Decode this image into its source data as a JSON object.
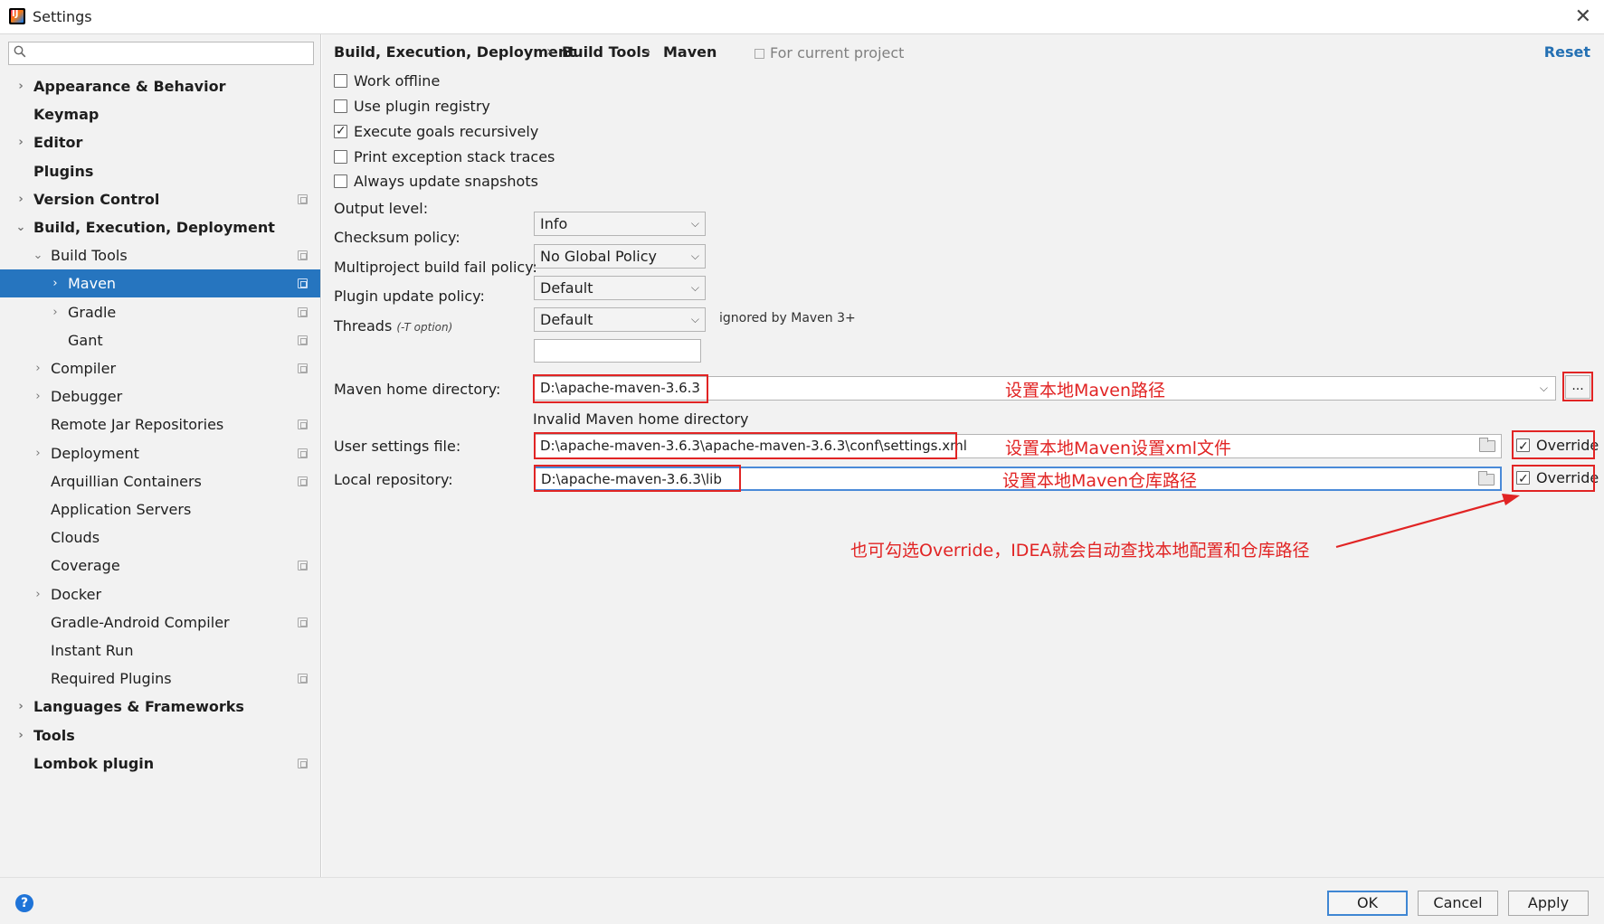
{
  "window": {
    "title": "Settings",
    "close": "✕"
  },
  "search": {
    "placeholder": ""
  },
  "tree": [
    {
      "label": "Appearance & Behavior",
      "arrow": "›",
      "bold": true,
      "indent": 0,
      "proj": false
    },
    {
      "label": "Keymap",
      "arrow": "",
      "bold": true,
      "indent": 0,
      "proj": false
    },
    {
      "label": "Editor",
      "arrow": "›",
      "bold": true,
      "indent": 0,
      "proj": false
    },
    {
      "label": "Plugins",
      "arrow": "",
      "bold": true,
      "indent": 0,
      "proj": false
    },
    {
      "label": "Version Control",
      "arrow": "›",
      "bold": true,
      "indent": 0,
      "proj": true
    },
    {
      "label": "Build, Execution, Deployment",
      "arrow": "⌄",
      "bold": true,
      "indent": 0,
      "proj": false
    },
    {
      "label": "Build Tools",
      "arrow": "⌄",
      "bold": false,
      "indent": 1,
      "proj": true
    },
    {
      "label": "Maven",
      "arrow": "›",
      "bold": false,
      "indent": 2,
      "proj": true,
      "selected": true
    },
    {
      "label": "Gradle",
      "arrow": "›",
      "bold": false,
      "indent": 2,
      "proj": true
    },
    {
      "label": "Gant",
      "arrow": "",
      "bold": false,
      "indent": 2,
      "proj": true
    },
    {
      "label": "Compiler",
      "arrow": "›",
      "bold": false,
      "indent": 1,
      "proj": true
    },
    {
      "label": "Debugger",
      "arrow": "›",
      "bold": false,
      "indent": 1,
      "proj": false
    },
    {
      "label": "Remote Jar Repositories",
      "arrow": "",
      "bold": false,
      "indent": 1,
      "proj": true
    },
    {
      "label": "Deployment",
      "arrow": "›",
      "bold": false,
      "indent": 1,
      "proj": true
    },
    {
      "label": "Arquillian Containers",
      "arrow": "",
      "bold": false,
      "indent": 1,
      "proj": true
    },
    {
      "label": "Application Servers",
      "arrow": "",
      "bold": false,
      "indent": 1,
      "proj": false
    },
    {
      "label": "Clouds",
      "arrow": "",
      "bold": false,
      "indent": 1,
      "proj": false
    },
    {
      "label": "Coverage",
      "arrow": "",
      "bold": false,
      "indent": 1,
      "proj": true
    },
    {
      "label": "Docker",
      "arrow": "›",
      "bold": false,
      "indent": 1,
      "proj": false
    },
    {
      "label": "Gradle-Android Compiler",
      "arrow": "",
      "bold": false,
      "indent": 1,
      "proj": true
    },
    {
      "label": "Instant Run",
      "arrow": "",
      "bold": false,
      "indent": 1,
      "proj": false
    },
    {
      "label": "Required Plugins",
      "arrow": "",
      "bold": false,
      "indent": 1,
      "proj": true
    },
    {
      "label": "Languages & Frameworks",
      "arrow": "›",
      "bold": true,
      "indent": 0,
      "proj": false
    },
    {
      "label": "Tools",
      "arrow": "›",
      "bold": true,
      "indent": 0,
      "proj": false
    },
    {
      "label": "Lombok plugin",
      "arrow": "",
      "bold": true,
      "indent": 0,
      "proj": true
    }
  ],
  "breadcrumb": {
    "item1": "Build, Execution, Deployment",
    "item2": "Build Tools",
    "item3": "Maven",
    "sep": "›"
  },
  "for_current_project": "For current project",
  "reset": "Reset",
  "options": {
    "work_offline": {
      "label": "Work offline",
      "checked": false
    },
    "use_plugin_registry": {
      "label": "Use plugin registry",
      "checked": false
    },
    "execute_goals": {
      "label": "Execute goals recursively",
      "checked": true
    },
    "print_exception": {
      "label": "Print exception stack traces",
      "checked": false
    },
    "always_update": {
      "label": "Always update snapshots",
      "checked": false
    }
  },
  "fields": {
    "output_level": {
      "label": "Output level:",
      "value": "Info"
    },
    "checksum_policy": {
      "label": "Checksum policy:",
      "value": "No Global Policy"
    },
    "multiproject_policy": {
      "label": "Multiproject build fail policy:",
      "value": "Default"
    },
    "plugin_update_policy": {
      "label": "Plugin update policy:",
      "value": "Default",
      "note": "ignored by Maven 3+"
    },
    "threads": {
      "label": "Threads",
      "hint": "(-T option)",
      "value": ""
    },
    "maven_home": {
      "label": "Maven home directory:",
      "value": "D:\\apache-maven-3.6.3",
      "error": "Invalid Maven home directory",
      "browse": "..."
    },
    "user_settings": {
      "label": "User settings file:",
      "value": "D:\\apache-maven-3.6.3\\apache-maven-3.6.3\\conf\\settings.xml",
      "override_label": "Override",
      "override_checked": true
    },
    "local_repo": {
      "label": "Local repository:",
      "value": "D:\\apache-maven-3.6.3\\lib",
      "override_label": "Override",
      "override_checked": true
    }
  },
  "annotations": {
    "maven_home": "设置本地Maven路径",
    "user_settings": "设置本地Maven设置xml文件",
    "local_repo": "设置本地Maven仓库路径",
    "override": "也可勾选Override，IDEA就会自动查找本地配置和仓库路径",
    "color": "#e12424"
  },
  "footer": {
    "help": "?",
    "ok": "OK",
    "cancel": "Cancel",
    "apply": "Apply"
  },
  "colors": {
    "selection": "#2675bf",
    "link": "#2470b3",
    "annotation": "#e12424",
    "focus": "#4a8ad8"
  }
}
